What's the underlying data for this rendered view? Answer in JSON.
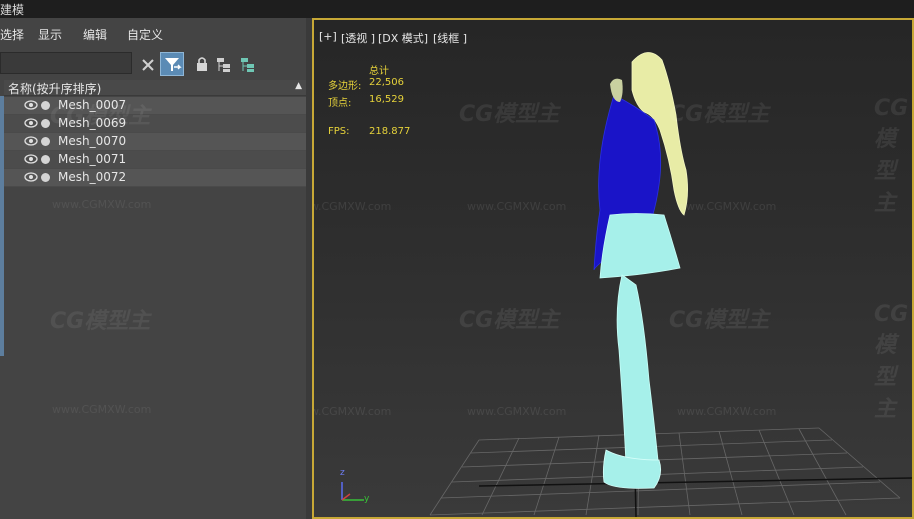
{
  "window": {
    "title": "建模"
  },
  "menu": {
    "items": [
      "选择",
      "显示",
      "编辑",
      "自定义"
    ]
  },
  "toolbar": {
    "search_value": ""
  },
  "scene_explorer": {
    "column_header": "名称(按升序排序)",
    "sort_indicator": "▲",
    "rows": [
      {
        "name": "Mesh_0007"
      },
      {
        "name": "Mesh_0069"
      },
      {
        "name": "Mesh_0070"
      },
      {
        "name": "Mesh_0071"
      },
      {
        "name": "Mesh_0072"
      }
    ]
  },
  "viewport": {
    "labels": [
      "[+]",
      "[透视 ]",
      "[DX 模式]",
      "[线框 ]"
    ],
    "stats": {
      "total_label": "总计",
      "poly_label": "多边形:",
      "poly_value": "22,506",
      "verts_label": "顶点:",
      "verts_value": "16,529",
      "fps_label": "FPS:",
      "fps_value": "218.877"
    },
    "axis": {
      "z": "z",
      "y": "y"
    }
  },
  "watermark": {
    "logo": "CG模型主",
    "url": "www.CGMXW.com"
  },
  "colors": {
    "viewport_border": "#c7a836",
    "stats_text": "#e6d23a",
    "hair": "#e8eca6",
    "jacket": "#1a14c8",
    "skirt_legs": "#a6f0ea",
    "grid": "#7a7a7a"
  }
}
